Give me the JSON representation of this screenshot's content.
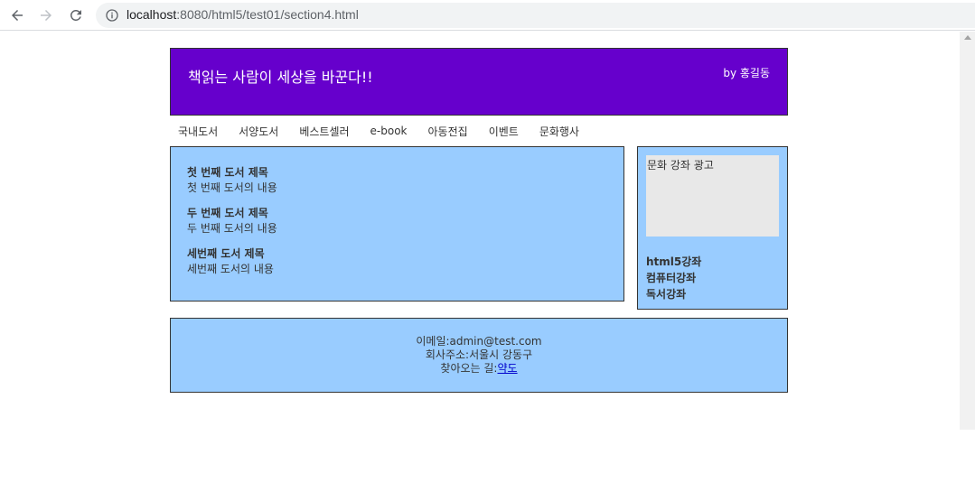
{
  "browser": {
    "url_host": "localhost",
    "url_path": ":8080/html5/test01/section4.html"
  },
  "header": {
    "title": "책읽는 사람이 세상을 바꾼다!!",
    "author": "by 홍길동"
  },
  "menu": {
    "items": [
      {
        "label": "국내도서"
      },
      {
        "label": "서양도서"
      },
      {
        "label": "베스트셀러"
      },
      {
        "label": "e-book"
      },
      {
        "label": "아동전집"
      },
      {
        "label": "이벤트"
      },
      {
        "label": "문화행사"
      }
    ]
  },
  "books": [
    {
      "title": "첫 번째 도서 제목",
      "content": "첫 번째 도서의 내용"
    },
    {
      "title": "두 번째 도서 제목",
      "content": "두 번째 도서의 내용"
    },
    {
      "title": "세번째 도서 제목",
      "content": "세번째 도서의 내용"
    }
  ],
  "aside": {
    "ad_text": "문화 강좌 광고",
    "lectures": [
      {
        "label": "html5강좌"
      },
      {
        "label": "컴퓨터강좌"
      },
      {
        "label": "독서강좌"
      }
    ]
  },
  "footer": {
    "email": "이메일:admin@test.com",
    "address": "회사주소:서울시 강동구",
    "directions_label": "찾아오는 길:",
    "directions_link": "약도"
  },
  "colors": {
    "header_bg": "#6600cc",
    "panel_bg": "#99ccff",
    "ad_bg": "#e8e8e8",
    "link": "#0000cc"
  }
}
